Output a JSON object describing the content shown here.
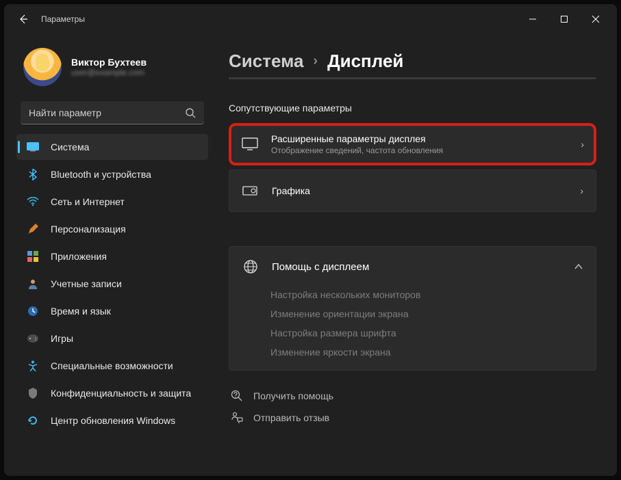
{
  "window_title": "Параметры",
  "profile": {
    "name": "Виктор Бухтеев",
    "email": "user@example.com"
  },
  "search": {
    "placeholder": "Найти параметр"
  },
  "nav": [
    {
      "label": "Система",
      "active": true,
      "icon": "system"
    },
    {
      "label": "Bluetooth и устройства",
      "active": false,
      "icon": "bluetooth"
    },
    {
      "label": "Сеть и Интернет",
      "active": false,
      "icon": "wifi"
    },
    {
      "label": "Персонализация",
      "active": false,
      "icon": "personalize"
    },
    {
      "label": "Приложения",
      "active": false,
      "icon": "apps"
    },
    {
      "label": "Учетные записи",
      "active": false,
      "icon": "accounts"
    },
    {
      "label": "Время и язык",
      "active": false,
      "icon": "time"
    },
    {
      "label": "Игры",
      "active": false,
      "icon": "gaming"
    },
    {
      "label": "Специальные возможности",
      "active": false,
      "icon": "accessibility"
    },
    {
      "label": "Конфиденциальность и защита",
      "active": false,
      "icon": "privacy"
    },
    {
      "label": "Центр обновления Windows",
      "active": false,
      "icon": "update"
    }
  ],
  "breadcrumb": {
    "parent": "Система",
    "current": "Дисплей"
  },
  "section_related": "Сопутствующие параметры",
  "cards": {
    "advanced": {
      "title": "Расширенные параметры дисплея",
      "subtitle": "Отображение сведений, частота обновления"
    },
    "graphics": {
      "title": "Графика"
    }
  },
  "help": {
    "header": "Помощь с дисплеем",
    "links": [
      "Настройка нескольких мониторов",
      "Изменение ориентации экрана",
      "Настройка размера шрифта",
      "Изменение яркости экрана"
    ]
  },
  "footer": {
    "get_help": "Получить помощь",
    "feedback": "Отправить отзыв"
  }
}
